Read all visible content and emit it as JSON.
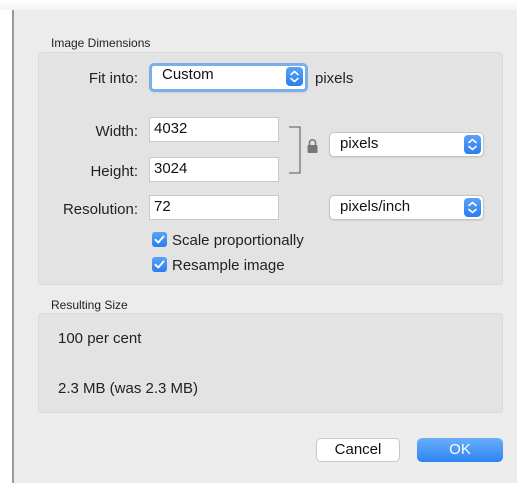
{
  "image_dimensions": {
    "title": "Image Dimensions",
    "fit_into": {
      "label": "Fit into:",
      "value": "Custom",
      "unit": "pixels"
    },
    "width": {
      "label": "Width:",
      "value": "4032"
    },
    "height": {
      "label": "Height:",
      "value": "3024"
    },
    "size_unit": {
      "value": "pixels"
    },
    "resolution": {
      "label": "Resolution:",
      "value": "72",
      "unit": "pixels/inch"
    },
    "scale_proportionally": {
      "label": "Scale proportionally",
      "checked": true
    },
    "resample_image": {
      "label": "Resample image",
      "checked": true
    }
  },
  "resulting_size": {
    "title": "Resulting Size",
    "percent": "100 per cent",
    "file_size": "2.3 MB (was 2.3 MB)"
  },
  "buttons": {
    "cancel": "Cancel",
    "ok": "OK"
  },
  "colors": {
    "accent": "#2b7ef0",
    "focus_ring": "#7ab0ea",
    "panel": "#ececec"
  },
  "icons": {
    "lock": "lock-icon",
    "stepper": "chevron-up-down-icon",
    "check": "checkmark-icon"
  }
}
